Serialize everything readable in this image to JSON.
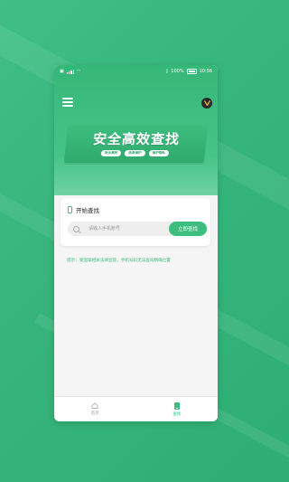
{
  "status_bar": {
    "left_icons": [
      "notification-icon",
      "signal-icon",
      "wifi-icon"
    ],
    "battery": "100%",
    "time": "10:56"
  },
  "header": {
    "menu_icon": "menu-icon",
    "logo_icon": "v-logo-icon"
  },
  "banner": {
    "title": "安全高效查找",
    "tags": [
      "安全高效",
      "信息保护",
      "保护隐私"
    ]
  },
  "search_card": {
    "title": "开始查找",
    "input_placeholder": "请输入手机账号",
    "button_label": "立即查找"
  },
  "tip": "提示：受国家相关法律监管，手机号码无法查询精确位置",
  "tabbar": {
    "items": [
      {
        "label": "首页",
        "icon": "home-icon",
        "active": false
      },
      {
        "label": "查找",
        "icon": "find-icon",
        "active": true
      }
    ]
  },
  "colors": {
    "accent": "#3dbd7e",
    "background": "#38b67c"
  }
}
